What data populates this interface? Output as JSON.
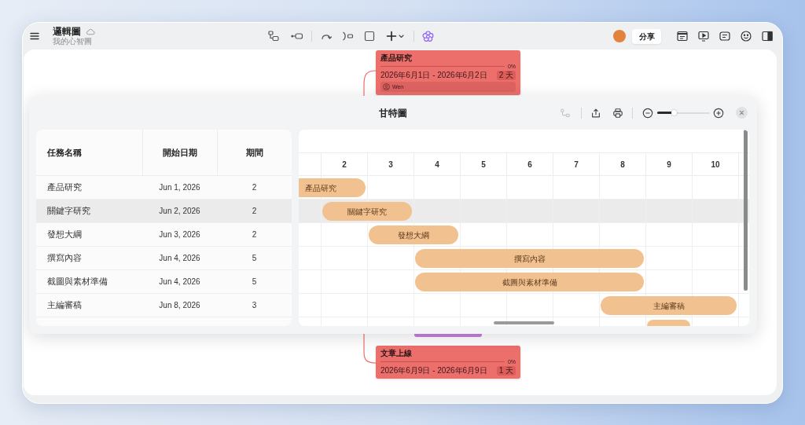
{
  "app": {
    "title": "邏輯圖",
    "subtitle": "我的心智圖",
    "share_button": "分享"
  },
  "mindmap_nodes": [
    {
      "title": "產品研究",
      "progress": {
        "level": 0,
        "reading": "0%"
      },
      "dates": "2026年6月1日 - 2026年6月2日",
      "duration": "2 天",
      "assignee": "Wen"
    },
    {
      "title": "文章上線",
      "progress": {
        "level": 0,
        "reading": "0%"
      },
      "dates": "2026年6月9日 - 2026年6月9日",
      "duration": "1 天"
    }
  ],
  "gantt": {
    "title": "甘特圖",
    "dependency_button": {
      "disabled": true
    },
    "zoom": {
      "level": 0.32
    },
    "columns": [
      "任務名稱",
      "開始日期",
      "期間"
    ],
    "days": [
      "2",
      "3",
      "4",
      "5",
      "6",
      "7",
      "8",
      "9",
      "10"
    ],
    "tasks": [
      {
        "name": "產品研究",
        "start": "Jun 1, 2026",
        "duration": "2",
        "bar_label": "產品研究",
        "selected": false
      },
      {
        "name": "關鍵字研究",
        "start": "Jun 2, 2026",
        "duration": "2",
        "bar_label": "關鍵字研究",
        "selected": true
      },
      {
        "name": "發想大綱",
        "start": "Jun 3, 2026",
        "duration": "2",
        "bar_label": "發想大綱",
        "selected": false
      },
      {
        "name": "撰寫內容",
        "start": "Jun 4, 2026",
        "duration": "5",
        "bar_label": "撰寫內容",
        "selected": false
      },
      {
        "name": "截圖與素材準備",
        "start": "Jun 4, 2026",
        "duration": "5",
        "bar_label": "截圖與素材準備",
        "selected": false
      },
      {
        "name": "主編審稿",
        "start": "Jun 8, 2026",
        "duration": "3",
        "bar_label": "主編審稿",
        "selected": false
      }
    ]
  }
}
